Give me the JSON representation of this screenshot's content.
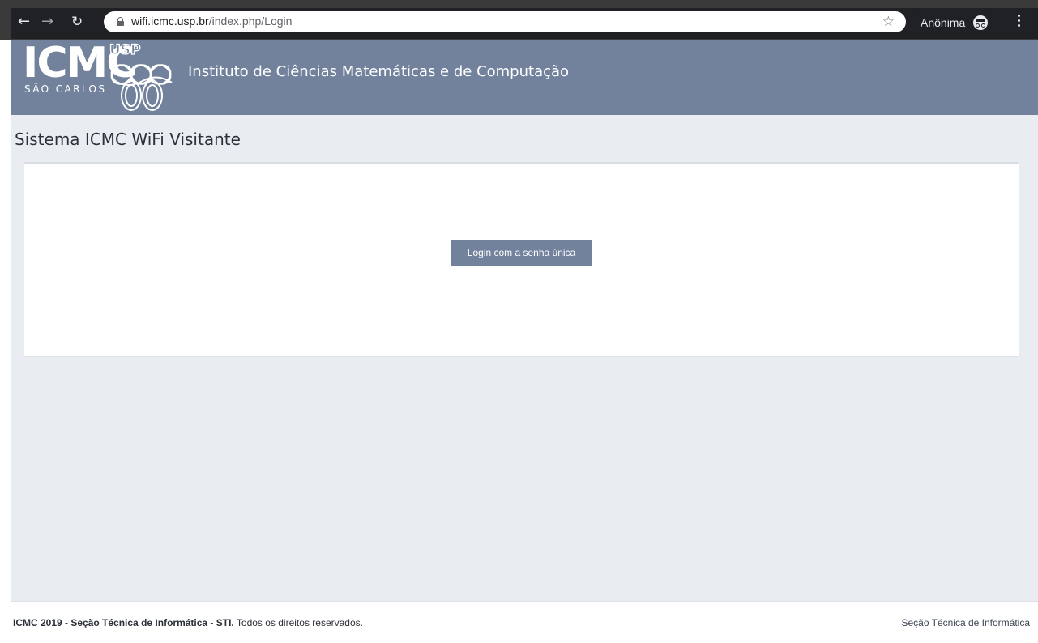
{
  "browser": {
    "url_host": "wifi.icmc.usp.br",
    "url_path": "/index.php/Login",
    "profile_label": "Anônima",
    "icons": [
      "back-arrow-icon",
      "forward-arrow-icon",
      "reload-icon",
      "lock-icon",
      "star-icon",
      "incognito-icon",
      "kebab-menu-icon"
    ]
  },
  "header": {
    "logo_text": "ICMC",
    "logo_subtext": "SÃO CARLOS",
    "logo_usp": "USP",
    "institute_name": "Instituto de Ciências Matemáticas e de Computação",
    "background_color": "#72829c"
  },
  "main": {
    "page_title": "Sistema ICMC WiFi Visitante",
    "login_button_label": "Login com a senha única",
    "accent_color": "#72829c"
  },
  "footer": {
    "copyright_bold": "ICMC 2019 - Seção Técnica de Informática - STI.",
    "copyright_rest": "Todos os direitos reservados.",
    "right_text": "Seção Técnica de Informática"
  }
}
